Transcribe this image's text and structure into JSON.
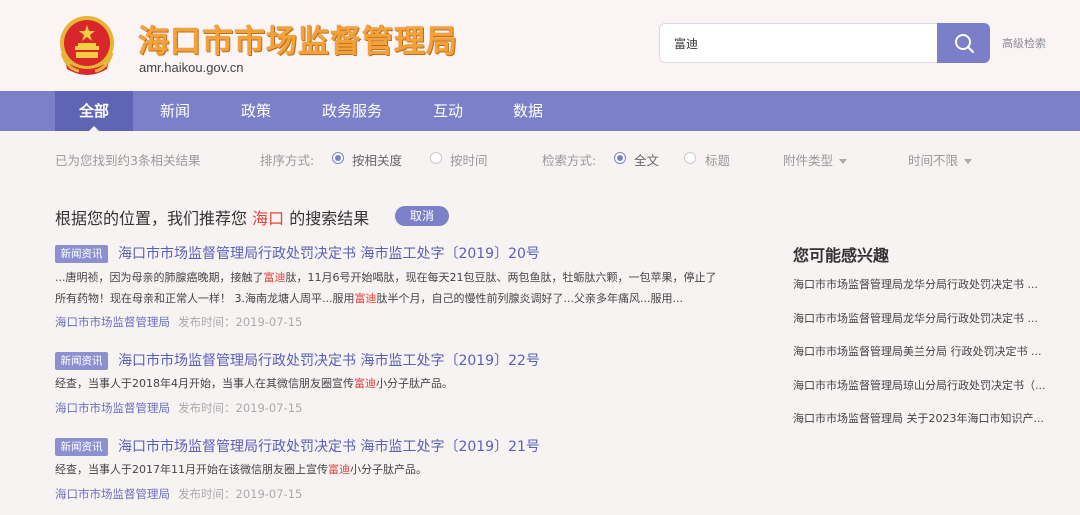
{
  "header": {
    "title": "海口市市场监督管理局",
    "url": "amr.haikou.gov.cn",
    "search_value": "富迪",
    "advanced_search": "高级检索"
  },
  "nav": {
    "items": [
      "全部",
      "新闻",
      "政策",
      "政务服务",
      "互动",
      "数据"
    ],
    "active": "全部"
  },
  "filter": {
    "result_count": "已为您找到约3条相关结果",
    "sort_label": "排序方式:",
    "sort_options": [
      "按相关度",
      "按时间"
    ],
    "sort_selected": "按相关度",
    "search_mode_label": "检索方式:",
    "search_mode_options": [
      "全文",
      "标题"
    ],
    "search_mode_selected": "全文",
    "attachment_type": "附件类型",
    "time_range": "时间不限"
  },
  "recommend": {
    "prefix": "根据您的位置，我们推荐您",
    "city": "海口",
    "suffix": "的搜索结果",
    "cancel": "取消"
  },
  "results": [
    {
      "tag": "新闻资讯",
      "title": "海口市市场监督管理局行政处罚决定书 海市监工处字〔2019〕20号",
      "snippet_lines": [
        [
          "...唐明祯，因为母亲的肺腺癌晚期，接触了",
          "富迪",
          "肽，11月6号开始喝肽，现在每天21包豆肽、两包鱼肽，牡蛎肽六颗，一包苹果，停止了"
        ],
        [
          "所有药物！现在母亲和正常人一样！        3.海南龙塘人周平...服用",
          "富迪",
          "肽半个月，自己的慢性前列腺炎调好了...父亲多年痛风...服用..."
        ]
      ],
      "source": "海口市市场监督管理局",
      "date": "发布时间：2019-07-15"
    },
    {
      "tag": "新闻资讯",
      "title": "海口市市场监督管理局行政处罚决定书 海市监工处字〔2019〕22号",
      "snippet_lines": [
        [
          "经查，当事人于2018年4月开始，当事人在其微信朋友圈宣传",
          "富迪",
          "小分子肽产品。"
        ]
      ],
      "source": "海口市市场监督管理局",
      "date": "发布时间：2019-07-15"
    },
    {
      "tag": "新闻资讯",
      "title": "海口市市场监督管理局行政处罚决定书 海市监工处字〔2019〕21号",
      "snippet_lines": [
        [
          "经查，当事人于2017年11月开始在该微信朋友圈上宣传",
          "富迪",
          "小分子肽产品。"
        ]
      ],
      "source": "海口市市场监督管理局",
      "date": "发布时间：2019-07-15"
    }
  ],
  "side": {
    "title": "您可能感兴趣",
    "items": [
      "海口市市场监督管理局龙华分局行政处罚决定书 ...",
      "海口市市场监督管理局龙华分局行政处罚决定书 ...",
      "海口市市场监督管理局美兰分局 行政处罚决定书 ...",
      "海口市市场监督管理局琼山分局行政处罚决定书（...",
      "海口市市场监督管理局 关于2023年海口市知识产..."
    ]
  },
  "colors": {
    "nav": "#7b80c9",
    "nav_active": "#5f64b5",
    "title_gold": "#f3a23a",
    "highlight": "#e2443b",
    "link": "#5a5fb8"
  },
  "icons": [
    "national-emblem-icon",
    "search-icon",
    "radio-icon",
    "chevron-down-icon"
  ]
}
